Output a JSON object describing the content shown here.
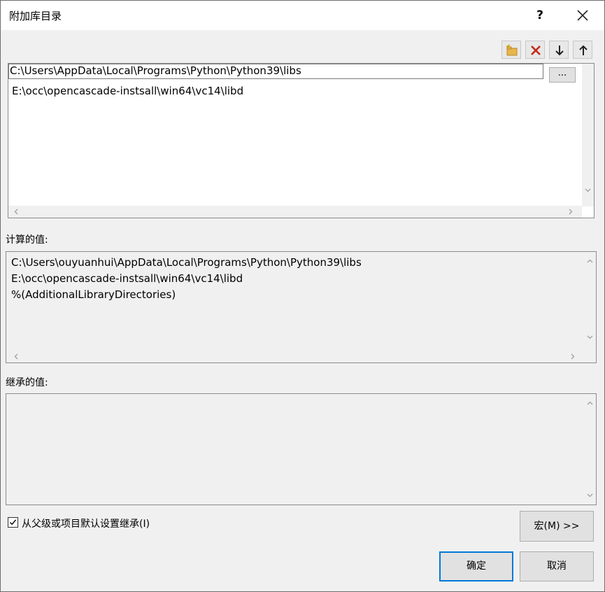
{
  "window": {
    "title": "附加库目录",
    "help": "?"
  },
  "toolbar": {
    "new_icon": "new-line-folder-icon",
    "delete_icon": "delete-x-icon",
    "move_down_icon": "arrow-down-icon",
    "move_up_icon": "arrow-up-icon"
  },
  "edit_list": {
    "editing_value": "C:\\Users\\AppData\\Local\\Programs\\Python\\Python39\\libs",
    "browse_label": "...",
    "items": [
      "E:\\occ\\opencascade-instsall\\win64\\vc14\\libd"
    ]
  },
  "computed": {
    "label": "计算的值:",
    "lines": [
      "C:\\Users\\ouyuanhui\\AppData\\Local\\Programs\\Python\\Python39\\libs",
      "E:\\occ\\opencascade-instsall\\win64\\vc14\\libd",
      "%(AdditionalLibraryDirectories)"
    ]
  },
  "inherited": {
    "label": "继承的值:"
  },
  "inherit_checkbox": {
    "label": "从父级或项目默认设置继承(I)",
    "checked": true
  },
  "buttons": {
    "macro": "宏(M) >>",
    "ok": "确定",
    "cancel": "取消"
  },
  "colors": {
    "accent": "#0078d7",
    "delete": "#c42b1c"
  }
}
